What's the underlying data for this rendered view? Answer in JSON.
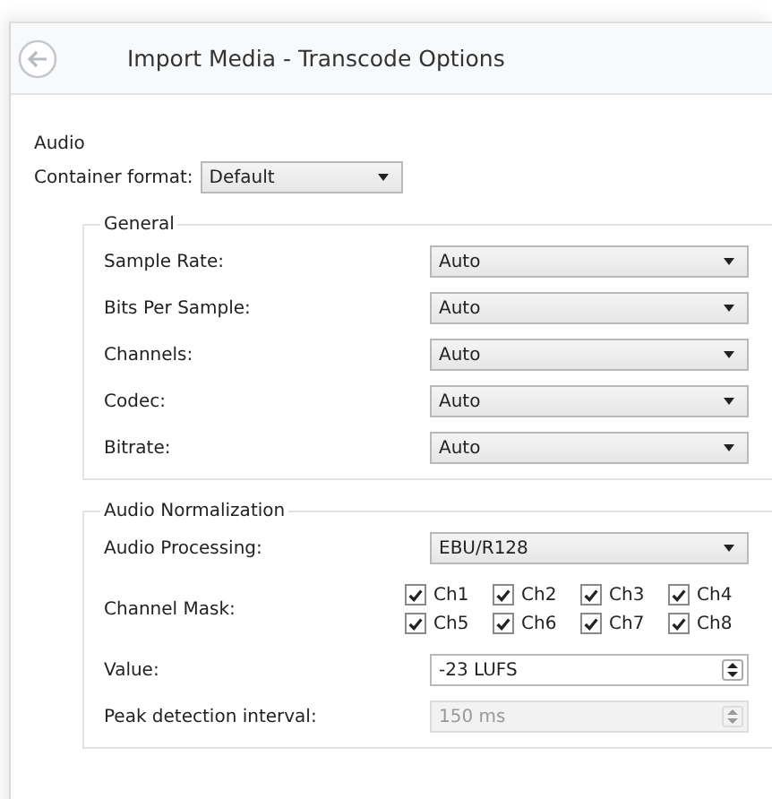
{
  "window": {
    "title": "Import Media - Transcode Options"
  },
  "audio": {
    "heading": "Audio",
    "container_format": {
      "label": "Container format:",
      "value": "Default"
    }
  },
  "general": {
    "title": "General",
    "fields": [
      {
        "label": "Sample Rate:",
        "value": "Auto"
      },
      {
        "label": "Bits Per Sample:",
        "value": "Auto"
      },
      {
        "label": "Channels:",
        "value": "Auto"
      },
      {
        "label": "Codec:",
        "value": "Auto"
      },
      {
        "label": "Bitrate:",
        "value": "Auto"
      }
    ]
  },
  "normalization": {
    "title": "Audio Normalization",
    "audio_processing": {
      "label": "Audio Processing:",
      "value": "EBU/R128"
    },
    "channel_mask": {
      "label": "Channel Mask:",
      "channels": [
        {
          "label": "Ch1",
          "checked": true
        },
        {
          "label": "Ch2",
          "checked": true
        },
        {
          "label": "Ch3",
          "checked": true
        },
        {
          "label": "Ch4",
          "checked": true
        },
        {
          "label": "Ch5",
          "checked": true
        },
        {
          "label": "Ch6",
          "checked": true
        },
        {
          "label": "Ch7",
          "checked": true
        },
        {
          "label": "Ch8",
          "checked": true
        }
      ]
    },
    "value": {
      "label": "Value:",
      "value": "-23 LUFS",
      "disabled": false
    },
    "peak_detection": {
      "label": "Peak detection interval:",
      "value": "150 ms",
      "disabled": true
    }
  }
}
